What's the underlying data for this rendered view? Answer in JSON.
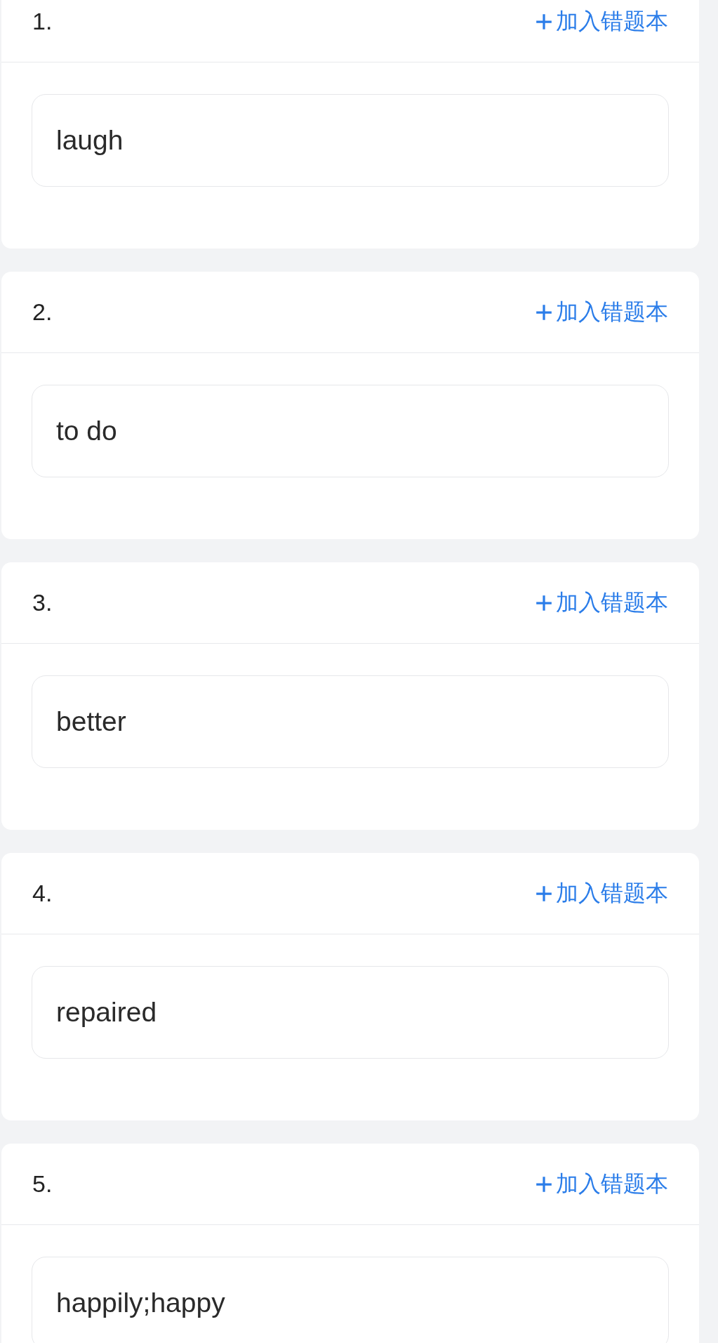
{
  "questions": [
    {
      "number": "1.",
      "action": "加入错题本",
      "answer": "laugh"
    },
    {
      "number": "2.",
      "action": "加入错题本",
      "answer": "to do"
    },
    {
      "number": "3.",
      "action": "加入错题本",
      "answer": "better"
    },
    {
      "number": "4.",
      "action": "加入错题本",
      "answer": "repaired"
    },
    {
      "number": "5.",
      "action": "加入错题本",
      "answer": "happily;happy"
    }
  ]
}
